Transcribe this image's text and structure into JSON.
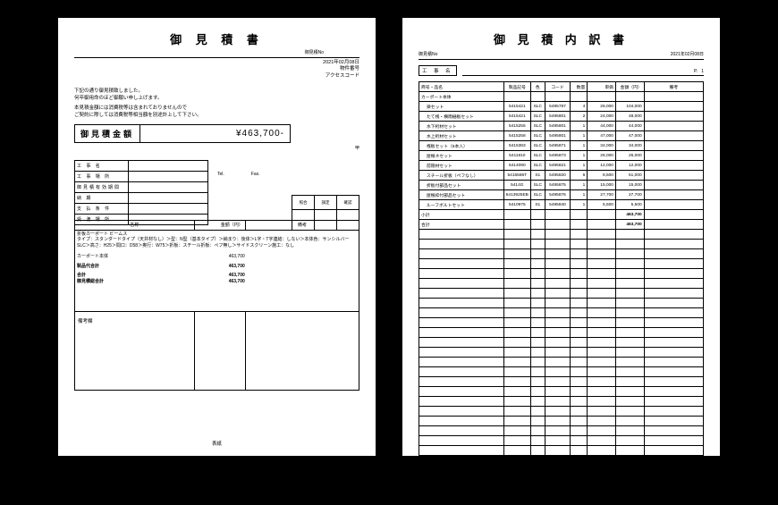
{
  "page1": {
    "title": "御 見 積 書",
    "estNoLabel": "御見積No",
    "date": "2021年02月08日",
    "propNoLabel": "物件番号",
    "accessLabel": "アクセスコード",
    "intro1": "下記の通り御見積致しました。",
    "intro2": "何卒御用命のほど御願い申し上げます。",
    "notice1": "本見積金額には消費税等は含まれておりませんので",
    "notice2": "ご契約に際しては消費税等相当額を別途計上して下さい。",
    "amountLabel": "御見積金額",
    "amountValue": "¥463,700-",
    "stampMark": "甲",
    "infoRows": [
      "工 事 名",
      "工 事 場 所",
      "御見積有効期間",
      "納 期",
      "支 払 条 件",
      "受 渡 場 所"
    ],
    "telLabel": "Tel.",
    "faxLabel": "Fax.",
    "stampCols": [
      "照合",
      "調定",
      "確認"
    ],
    "colName": "名称",
    "colAmt": "金額（円）",
    "colNote": "備考",
    "specLine1": "折板カーポート ビームス",
    "specLine2": "タイプ：スタンダードタイプ（天井材なし）＞型：N型（基本タイプ）＞納まり：後体＞L字・T字連結：しない＞本体色：サンシルバー　SLC＞高さ：H25＞間口：D58＞奥行：W75＞折板：スチール折板：ペフ無し＞サイドスクリーン施工：なし",
    "rows": [
      {
        "name": "カーポート本体",
        "amt": "463,700"
      },
      {
        "name": "製品代合計",
        "amt": "463,700"
      },
      {
        "name": "合計",
        "amt": "463,700"
      },
      {
        "name": "御見積総合計",
        "amt": "463,700"
      }
    ],
    "noteLabel": "備考欄",
    "footer": "表紙"
  },
  "page2": {
    "title": "御 見 積 内 訳 書",
    "estNoLabel": "御見積No",
    "date": "2021年02月08日",
    "kojiLabel": "工 事 名",
    "pageLabelP": "P.",
    "pageNo": "1",
    "headers": {
      "name": "商号・品名",
      "code": "製品記号",
      "color": "色",
      "pcode": "コード",
      "qty": "数量",
      "unit": "単価",
      "amt": "金額（円）",
      "note": "備考"
    },
    "sectionName": "カーポート本体",
    "items": [
      {
        "name": "梁セット",
        "code": "5415421",
        "color": "SLC",
        "pcode": "5495787",
        "qty": "4",
        "unit": "26,000",
        "amt": "104,000"
      },
      {
        "name": "たて桟・横雨樋板セット",
        "code": "5415421",
        "color": "SLC",
        "pcode": "5495801",
        "qty": "2",
        "unit": "24,000",
        "amt": "48,000"
      },
      {
        "name": "水下桁材セット",
        "code": "5415255",
        "color": "SLC",
        "pcode": "5495801",
        "qty": "1",
        "unit": "44,000",
        "amt": "44,000"
      },
      {
        "name": "水上桁材セット",
        "code": "5415258",
        "color": "SLC",
        "pcode": "5495801",
        "qty": "1",
        "unit": "47,000",
        "amt": "47,000"
      },
      {
        "name": "桟板セット（5本入）",
        "code": "5415383",
        "color": "SLC",
        "pcode": "5495871",
        "qty": "1",
        "unit": "34,000",
        "amt": "34,000"
      },
      {
        "name": "屋根ネセット",
        "code": "5411810",
        "color": "SLC",
        "pcode": "5495873",
        "qty": "1",
        "unit": "26,000",
        "amt": "26,000"
      },
      {
        "name": "前隠材セット",
        "code": "5414090",
        "color": "SLC",
        "pcode": "5495821",
        "qty": "1",
        "unit": "12,000",
        "amt": "12,000"
      },
      {
        "name": "スチール折板（ペフなし）",
        "code": "5415586T",
        "color": "S1",
        "pcode": "5495820",
        "qty": "6",
        "unit": "8,500",
        "amt": "51,000"
      },
      {
        "name": "折板付部品セット",
        "code": "5414G",
        "color": "SLC",
        "pcode": "5495875",
        "qty": "1",
        "unit": "15,000",
        "amt": "15,000"
      },
      {
        "name": "屋根枠付部品セット",
        "code": "5413925EB",
        "color": "SLC",
        "pcode": "5495876",
        "qty": "1",
        "unit": "27,700",
        "amt": "27,700"
      },
      {
        "name": "ルーフボルトセット",
        "code": "5410975",
        "color": "S1",
        "pcode": "5495840",
        "qty": "1",
        "unit": "5,500",
        "amt": "5,500"
      }
    ],
    "subtotalLabel": "小計",
    "subtotalAmt": "463,700",
    "totalLabel": "合計",
    "totalAmt": "463,700"
  }
}
